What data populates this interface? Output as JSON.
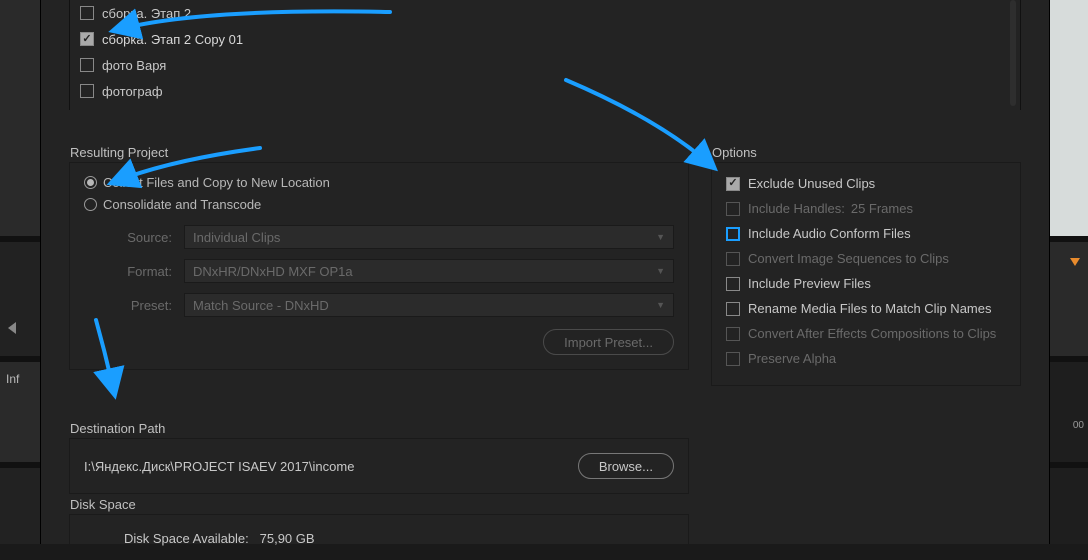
{
  "list": {
    "items": [
      {
        "label": "сборка. Этап 2",
        "checked": false
      },
      {
        "label": "сборка. Этап 2 Copy 01",
        "checked": true
      },
      {
        "label": "фото Варя",
        "checked": false
      },
      {
        "label": "фотограф",
        "checked": false
      }
    ]
  },
  "resulting_project": {
    "title": "Resulting Project",
    "collect_label": "Collect Files and Copy to New Location",
    "consolidate_label": "Consolidate and Transcode",
    "source_label": "Source:",
    "source_value": "Individual Clips",
    "format_label": "Format:",
    "format_value": "DNxHR/DNxHD MXF OP1a",
    "preset_label": "Preset:",
    "preset_value": "Match Source - DNxHD",
    "import_preset_label": "Import Preset..."
  },
  "options": {
    "title": "Options",
    "items": [
      {
        "label": "Exclude Unused Clips",
        "checked": true,
        "enabled": true,
        "blue": false
      },
      {
        "label": "Include Handles:",
        "suffix": "25 Frames",
        "checked": false,
        "enabled": false,
        "blue": false
      },
      {
        "label": "Include Audio Conform Files",
        "checked": false,
        "enabled": true,
        "blue": true
      },
      {
        "label": "Convert Image Sequences to Clips",
        "checked": false,
        "enabled": false,
        "blue": false
      },
      {
        "label": "Include Preview Files",
        "checked": false,
        "enabled": true,
        "blue": false
      },
      {
        "label": "Rename Media Files to Match Clip Names",
        "checked": false,
        "enabled": true,
        "blue": false
      },
      {
        "label": "Convert After Effects Compositions to Clips",
        "checked": false,
        "enabled": false,
        "blue": false
      },
      {
        "label": "Preserve Alpha",
        "checked": false,
        "enabled": false,
        "blue": false
      }
    ]
  },
  "destination": {
    "title": "Destination Path",
    "path": "I:\\Яндекс.Диск\\PROJECT ISAEV 2017\\income",
    "browse_label": "Browse..."
  },
  "disk_space": {
    "title": "Disk Space",
    "available_label": "Disk Space Available:",
    "available_value": "75,90 GB"
  },
  "left_strip": {
    "info_short": "Inf"
  },
  "ruler": {
    "mark": "00"
  }
}
